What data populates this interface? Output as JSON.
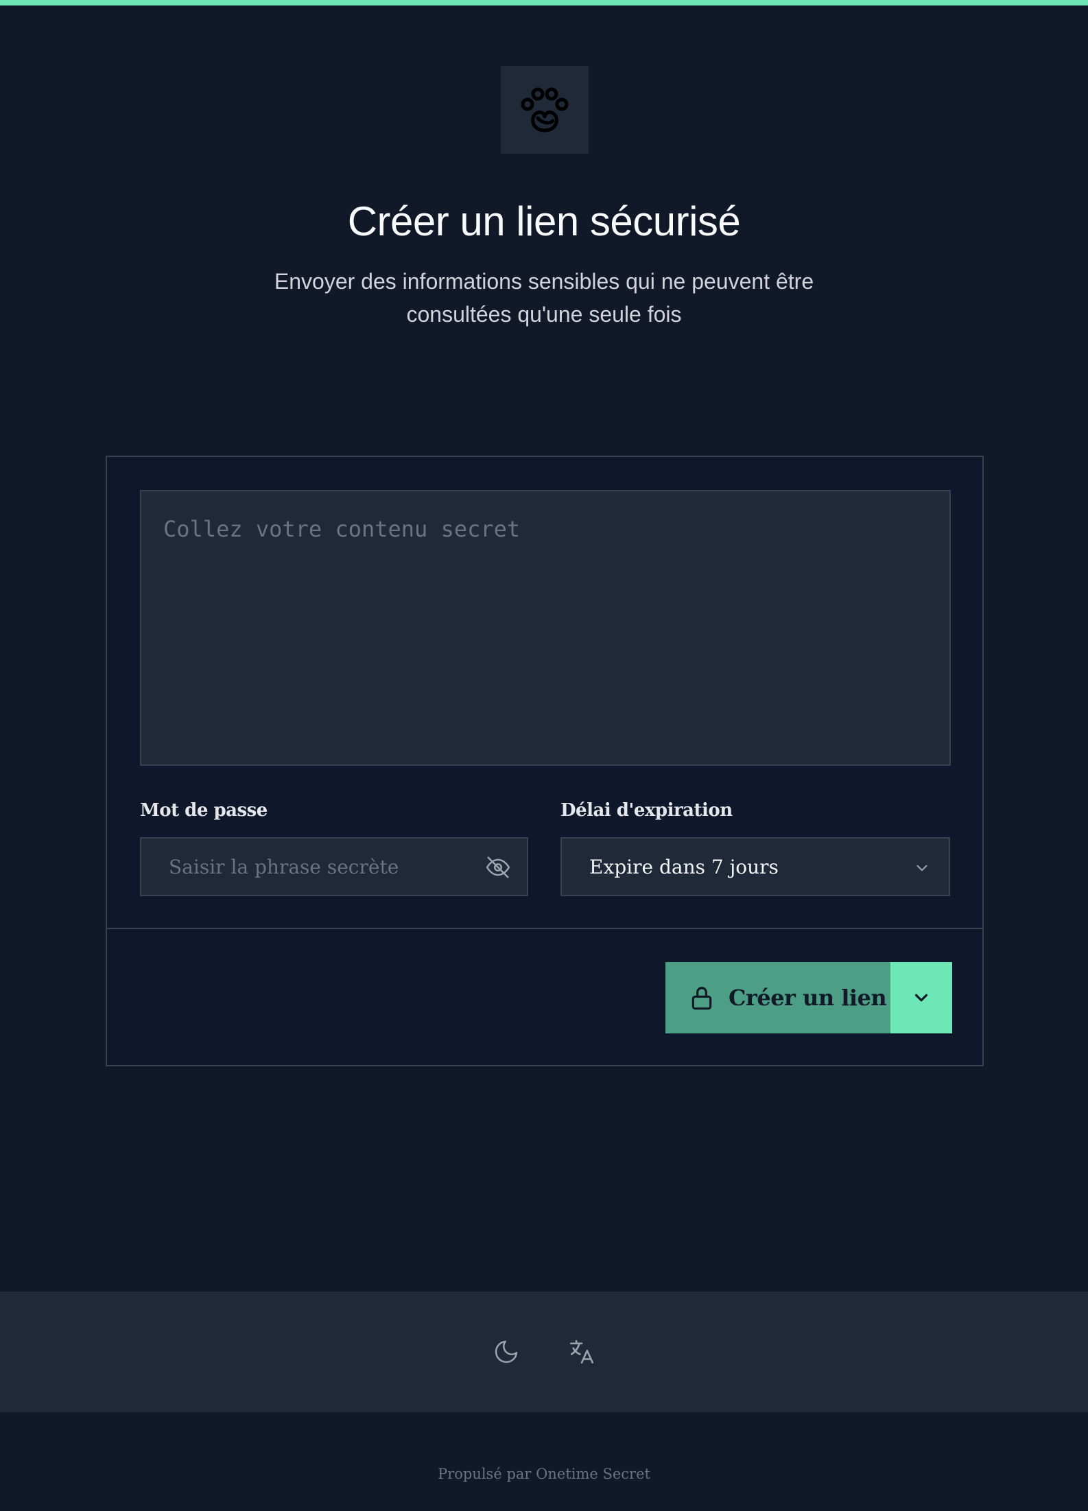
{
  "header": {
    "logo_icon": "paw-heart-icon",
    "title": "Créer un lien sécurisé",
    "subtitle": "Envoyer des informations sensibles qui ne peuvent être consultées qu'une seule fois"
  },
  "form": {
    "secret_placeholder": "Collez votre contenu secret",
    "password": {
      "label": "Mot de passe",
      "placeholder": "Saisir la phrase secrète",
      "toggle_icon": "eye-off-icon"
    },
    "expiration": {
      "label": "Délai d'expiration",
      "selected": "Expire dans 7 jours",
      "icon": "chevron-down-icon"
    },
    "submit": {
      "label": "Créer un lien",
      "icon": "lock-icon",
      "dropdown_icon": "chevron-down-icon"
    }
  },
  "footer": {
    "theme_icon": "moon-icon",
    "language_icon": "translate-icon",
    "powered_by": "Propulsé par Onetime Secret"
  },
  "colors": {
    "accent": "#6ee7b7",
    "button": "#4c9e85",
    "background": "#111827",
    "surface": "#1f2937",
    "border": "#374151"
  }
}
